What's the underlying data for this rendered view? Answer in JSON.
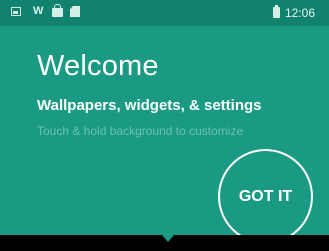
{
  "status_bar": {
    "icons": [
      "image-icon",
      "w-icon",
      "bag-icon",
      "sd-card-icon",
      "battery-icon"
    ],
    "w_glyph": "W",
    "time": "12:06"
  },
  "welcome": {
    "title": "Welcome",
    "subtitle": "Wallpapers, widgets, & settings",
    "hint": "Touch & hold background to customize"
  },
  "cling": {
    "button_label": "GOT IT"
  },
  "colors": {
    "background": "#1a9a82",
    "status_bar": "#10826d",
    "hint_text": "#67c3ae"
  }
}
